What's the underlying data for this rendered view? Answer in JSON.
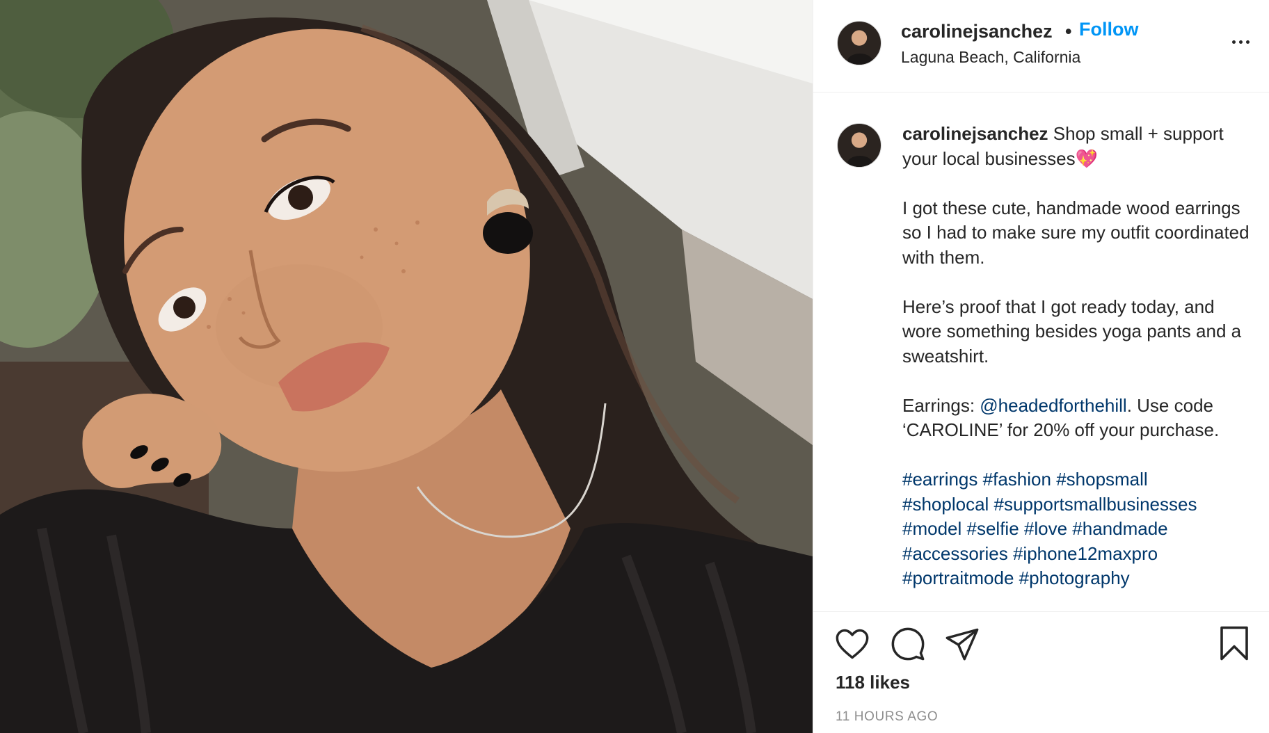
{
  "post": {
    "username": "carolinejsanchez",
    "separator": "•",
    "follow_label": "Follow",
    "location": "Laguna Beach, California",
    "more_icon": "more-options-icon",
    "image_alt": "Selfie of a woman with long dark hair, freckles, wood earrings and a black knit sweater"
  },
  "caption": {
    "username": "carolinejsanchez",
    "line1": " Shop small + support your local businesses💖",
    "para2": "I got these cute, handmade wood earrings so I had to make sure my outfit coordinated with them.",
    "para3": "Here’s proof that I got ready today, and wore something besides yoga pants and a sweatshirt.",
    "para4_prefix": "Earrings: ",
    "mention": "@headedforthehill",
    "para4_suffix": ". Use code ‘CAROLINE’ for 20% off your purchase.",
    "hashtags": [
      "#earrings",
      "#fashion",
      "#shopsmall",
      "#shoplocal",
      "#supportsmallbusinesses",
      "#model",
      "#selfie",
      "#love",
      "#handmade",
      "#accessories",
      "#iphone12maxpro",
      "#portraitmode",
      "#photography"
    ]
  },
  "actions": {
    "icons": [
      "heart-icon",
      "comment-icon",
      "share-icon",
      "bookmark-icon"
    ],
    "likes": "118 likes",
    "timestamp": "11 HOURS AGO"
  }
}
